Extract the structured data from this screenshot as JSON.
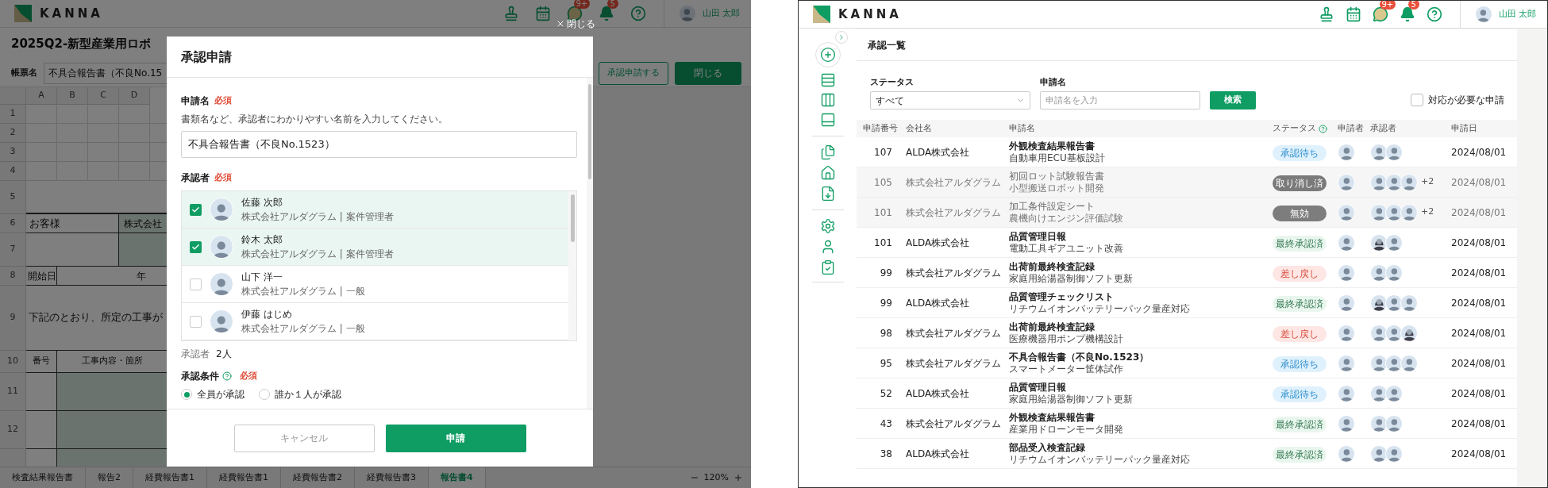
{
  "left_screen": {
    "header": {
      "logo": "KANNA",
      "user_name": "山田 太郎",
      "chat_badge": "9+",
      "notification_badge": "5"
    },
    "close_link": "閉じる",
    "document_title": "2025Q2-新型産業用ロボ",
    "toolbar": {
      "form_name_label": "帳票名",
      "form_name_value": "不具合報告書（不良No.15",
      "buttons": [
        {
          "label": "承認申請する",
          "kind": "outline"
        },
        {
          "label": "閉じる",
          "kind": "primary"
        }
      ]
    },
    "sheet": {
      "columns": [
        "A",
        "B",
        "C",
        "D"
      ],
      "row_numbers": [
        "1",
        "2",
        "3",
        "4",
        "5",
        "6",
        "7",
        "8",
        "9",
        "10",
        "11",
        "12"
      ],
      "cells": {
        "customer_label": "お客様",
        "company": "株式会社",
        "start_date_label": "開始日",
        "year": "年",
        "notice": "下記のとおり、所定の工事が",
        "number_header": "番号",
        "work_header": "工事内容・箇所"
      }
    },
    "sheet_tabs": [
      {
        "label": "検査結果報告書",
        "selected": false
      },
      {
        "label": "報告2",
        "selected": false
      },
      {
        "label": "経費報告書1",
        "selected": false
      },
      {
        "label": "経費報告書1",
        "selected": false
      },
      {
        "label": "経費報告書2",
        "selected": false
      },
      {
        "label": "経費報告書3",
        "selected": false
      },
      {
        "label": "報告書4",
        "selected": true
      }
    ],
    "zoom": "120%",
    "dialog": {
      "title": "承認申請",
      "name_field": {
        "label": "申請名",
        "required": "必須",
        "hint": "書類名など、承認者にわかりやすい名前を入力してください。",
        "value": "不具合報告書（不良No.1523）"
      },
      "approvers": {
        "label": "承認者",
        "required": "必須",
        "items": [
          {
            "name": "佐藤 次郎",
            "org": "株式会社アルダグラム | 案件管理者",
            "checked": true
          },
          {
            "name": "鈴木 太郎",
            "org": "株式会社アルダグラム | 案件管理者",
            "checked": true
          },
          {
            "name": "山下 洋一",
            "org": "株式会社アルダグラム | 一般",
            "checked": false
          },
          {
            "name": "伊藤 はじめ",
            "org": "株式会社アルダグラム | 一般",
            "checked": false
          }
        ],
        "count_label": "承認者",
        "count_value": "2人"
      },
      "condition": {
        "label": "承認条件",
        "required": "必須",
        "options": [
          {
            "label": "全員が承認",
            "selected": true
          },
          {
            "label": "誰か１人が承認",
            "selected": false
          }
        ]
      },
      "buttons": [
        {
          "label": "キャンセル",
          "kind": "secondary"
        },
        {
          "label": "申請",
          "kind": "primary"
        }
      ]
    }
  },
  "right_screen": {
    "header": {
      "logo": "KANNA",
      "user_name": "山田 太郎",
      "chat_badge": "9+",
      "notification_badge": "5"
    },
    "page_title": "承認一覧",
    "filters": {
      "status_label": "ステータス",
      "status_value": "すべて",
      "name_label": "申請名",
      "name_placeholder": "申請名を入力",
      "search_button": "検索",
      "needs_action": {
        "label": "対応が必要な申請",
        "checked": false
      }
    },
    "table": {
      "columns": [
        "申請番号",
        "会社名",
        "申請名",
        "ステータス",
        "申請者",
        "承認者",
        "申請日"
      ],
      "rows": [
        {
          "id": "107",
          "company": "ALDA株式会社",
          "title": "外観検査結果報告書",
          "subtitle": "自動車用ECU基板設計",
          "status": {
            "label": "承認待ち",
            "kind": "pending"
          },
          "approvers": [
            {
              "kind": "man"
            },
            {
              "kind": "man"
            }
          ],
          "date": "2024/08/01",
          "disabled": false
        },
        {
          "id": "105",
          "company": "株式会社アルダグラム",
          "title": "初回ロット試験報告書",
          "subtitle": "小型搬送ロボット開発",
          "status": {
            "label": "取り消し済",
            "kind": "cancelled"
          },
          "approvers": [
            {
              "kind": "man"
            },
            {
              "kind": "man"
            },
            {
              "kind": "man"
            }
          ],
          "more": "+2",
          "date": "2024/08/01",
          "disabled": true
        },
        {
          "id": "101",
          "company": "株式会社アルダグラム",
          "title": "加工条件設定シート",
          "subtitle": "農機向けエンジン評価試験",
          "status": {
            "label": "無効",
            "kind": "invalid"
          },
          "approvers": [
            {
              "kind": "man"
            },
            {
              "kind": "man"
            },
            {
              "kind": "man"
            }
          ],
          "more": "+2",
          "date": "2024/08/01",
          "disabled": true
        },
        {
          "id": "101",
          "company": "ALDA株式会社",
          "title": "品質管理日報",
          "subtitle": "電動工具ギアユニット改善",
          "status": {
            "label": "最終承認済",
            "kind": "approved"
          },
          "approvers": [
            {
              "kind": "woman"
            },
            {
              "kind": "man"
            }
          ],
          "date": "2024/08/01",
          "disabled": false
        },
        {
          "id": "99",
          "company": "株式会社アルダグラム",
          "title": "出荷前最終検査記録",
          "subtitle": "家庭用給湯器制御ソフト更新",
          "status": {
            "label": "差し戻し",
            "kind": "returned"
          },
          "approvers": [
            {
              "kind": "man"
            },
            {
              "kind": "man"
            }
          ],
          "date": "2024/08/01",
          "disabled": false
        },
        {
          "id": "99",
          "company": "ALDA株式会社",
          "title": "品質管理チェックリスト",
          "subtitle": "リチウムイオンバッテリーパック量産対応",
          "status": {
            "label": "最終承認済",
            "kind": "approved"
          },
          "approvers": [
            {
              "kind": "woman"
            },
            {
              "kind": "man"
            },
            {
              "kind": "man"
            }
          ],
          "date": "2024/08/01",
          "disabled": false
        },
        {
          "id": "98",
          "company": "株式会社アルダグラム",
          "title": "出荷前最終検査記録",
          "subtitle": "医療機器用ポンプ機構設計",
          "status": {
            "label": "差し戻し",
            "kind": "returned"
          },
          "approvers": [
            {
              "kind": "man"
            },
            {
              "kind": "man"
            },
            {
              "kind": "woman"
            }
          ],
          "date": "2024/08/01",
          "disabled": false
        },
        {
          "id": "95",
          "company": "株式会社アルダグラム",
          "title": "不具合報告書（不良No.1523）",
          "subtitle": "スマートメーター筐体試作",
          "status": {
            "label": "承認待ち",
            "kind": "pending"
          },
          "approvers": [
            {
              "kind": "man"
            },
            {
              "kind": "man"
            },
            {
              "kind": "man"
            }
          ],
          "date": "2024/08/01",
          "disabled": false
        },
        {
          "id": "52",
          "company": "ALDA株式会社",
          "title": "品質管理日報",
          "subtitle": "家庭用給湯器制御ソフト更新",
          "status": {
            "label": "承認待ち",
            "kind": "pending"
          },
          "approvers": [
            {
              "kind": "man"
            },
            {
              "kind": "man"
            }
          ],
          "date": "2024/08/01",
          "disabled": false
        },
        {
          "id": "43",
          "company": "株式会社アルダグラム",
          "title": "外観検査結果報告書",
          "subtitle": "産業用ドローンモータ開発",
          "status": {
            "label": "最終承認済",
            "kind": "approved"
          },
          "approvers": [
            {
              "kind": "man"
            },
            {
              "kind": "man"
            }
          ],
          "date": "2024/08/01",
          "disabled": false
        },
        {
          "id": "38",
          "company": "ALDA株式会社",
          "title": "部品受入検査記録",
          "subtitle": "リチウムイオンバッテリーパック量産対応",
          "status": {
            "label": "最終承認済",
            "kind": "approved"
          },
          "approvers": [
            {
              "kind": "man"
            },
            {
              "kind": "man"
            }
          ],
          "date": "2024/08/01",
          "disabled": false
        }
      ]
    }
  }
}
